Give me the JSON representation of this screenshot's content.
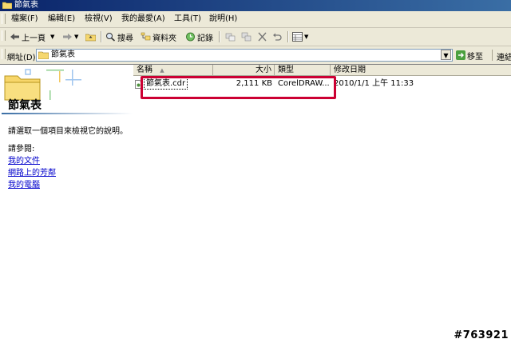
{
  "window": {
    "title": "節氣表"
  },
  "menu": [
    "檔案(F)",
    "編輯(E)",
    "檢視(V)",
    "我的最愛(A)",
    "工具(T)",
    "說明(H)"
  ],
  "toolbar": {
    "back": "上一頁",
    "search": "搜尋",
    "folders": "資料夾",
    "history": "記錄"
  },
  "address": {
    "label": "網址(D)",
    "value": "節氣表",
    "go": "移至",
    "links": "連結"
  },
  "left_pane": {
    "title": "節氣表",
    "description": "請選取一個項目來檢視它的說明。",
    "see_also": "請參閱:",
    "links": [
      "我的文件",
      "網路上的芳鄰",
      "我的電腦"
    ]
  },
  "columns": {
    "name": "名稱",
    "size": "大小",
    "type": "類型",
    "modified": "修改日期"
  },
  "files": [
    {
      "name": "節氣表.cdr",
      "size": "2,111 KB",
      "type": "CorelDRAW...",
      "modified": "2010/1/1 上午 11:33"
    }
  ],
  "accent_colors": {
    "titlebar": "#0a246a",
    "highlight": "#cc0033",
    "link": "#0000cc"
  },
  "watermark": "#763921"
}
